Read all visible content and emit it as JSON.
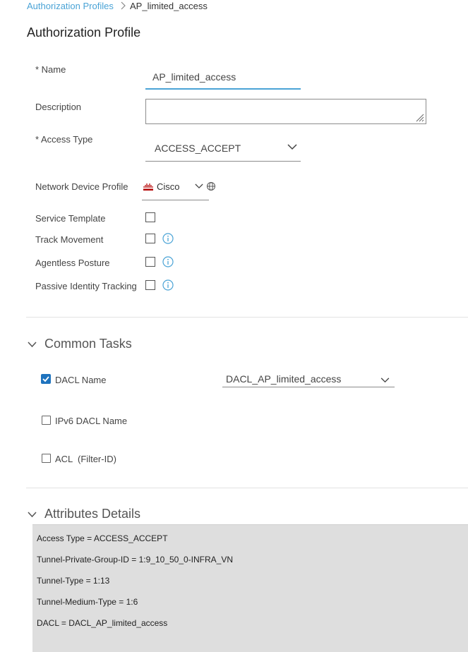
{
  "breadcrumb": {
    "parent": "Authorization Profiles",
    "current": "AP_limited_access"
  },
  "page_title": "Authorization Profile",
  "form": {
    "name_label": "* Name",
    "name_value": "AP_limited_access",
    "description_label": "Description",
    "description_value": "",
    "access_type_label": "* Access Type",
    "access_type_value": "ACCESS_ACCEPT",
    "ndp_label": "Network Device Profile",
    "ndp_value": "Cisco",
    "service_template_label": "Service Template",
    "track_movement_label": "Track Movement",
    "agentless_posture_label": "Agentless Posture",
    "passive_identity_label": "Passive Identity Tracking"
  },
  "common_tasks": {
    "title": "Common Tasks",
    "dacl_label": "DACL Name",
    "dacl_checked": true,
    "dacl_value": "DACL_AP_limited_access",
    "ipv6_dacl_label": "IPv6 DACL Name",
    "acl_label": "ACL  (Filter-ID)"
  },
  "attributes": {
    "title": "Attributes Details",
    "lines": [
      "Access Type = ACCESS_ACCEPT",
      "Tunnel-Private-Group-ID = 1:9_10_50_0-INFRA_VN",
      "Tunnel-Type = 1:13",
      "Tunnel-Medium-Type = 1:6",
      "DACL = DACL_AP_limited_access"
    ]
  },
  "colors": {
    "link": "#4aa3d6",
    "accent": "#1e73be",
    "attr_bg": "#dedede"
  }
}
